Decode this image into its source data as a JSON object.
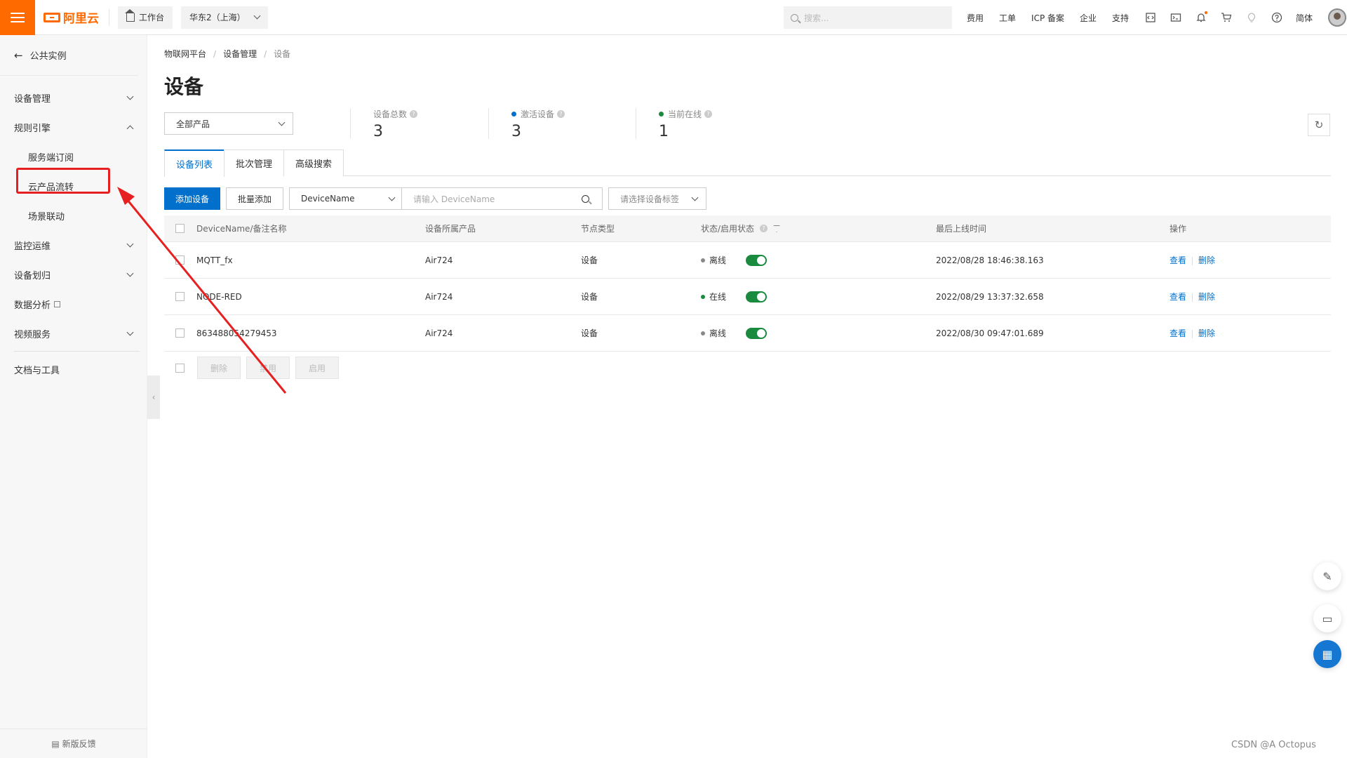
{
  "topbar": {
    "logo_text": "阿里云",
    "workbench_label": "工作台",
    "region_label": "华东2（上海）",
    "search_placeholder": "搜索...",
    "links": [
      "费用",
      "工单",
      "ICP 备案",
      "企业",
      "支持"
    ],
    "lang_label": "简体",
    "icons": [
      "code-icon",
      "terminal-icon",
      "bell-icon",
      "cart-icon",
      "bulb-icon",
      "help-icon"
    ]
  },
  "sidebar": {
    "back_label": "公共实例",
    "items": [
      {
        "label": "设备管理",
        "expanded": false
      },
      {
        "label": "规则引擎",
        "expanded": true
      },
      {
        "label": "服务端订阅",
        "sub": true
      },
      {
        "label": "云产品流转",
        "sub": true,
        "highlighted": true
      },
      {
        "label": "场景联动",
        "sub": true
      },
      {
        "label": "监控运维",
        "expanded": false
      },
      {
        "label": "设备划归",
        "expanded": false
      },
      {
        "label": "数据分析",
        "external": true
      },
      {
        "label": "视频服务",
        "expanded": false
      },
      {
        "label": "文档与工具"
      }
    ],
    "feedback_label": "新版反馈"
  },
  "main": {
    "breadcrumb": [
      "物联网平台",
      "设备管理",
      "设备"
    ],
    "title": "设备",
    "product_select": "全部产品",
    "stats": [
      {
        "label": "设备总数",
        "value": "3",
        "dot": null
      },
      {
        "label": "激活设备",
        "value": "3",
        "dot": "#0070cc"
      },
      {
        "label": "当前在线",
        "value": "1",
        "dot": "#1a8a3f"
      }
    ],
    "tabs": [
      "设备列表",
      "批次管理",
      "高级搜索"
    ],
    "toolbar": {
      "add_device": "添加设备",
      "batch_add": "批量添加",
      "field_select": "DeviceName",
      "search_placeholder": "请输入 DeviceName",
      "tag_placeholder": "请选择设备标签"
    },
    "table": {
      "headers": [
        "DeviceName/备注名称",
        "设备所属产品",
        "节点类型",
        "状态/启用状态",
        "最后上线时间",
        "操作"
      ],
      "rows": [
        {
          "name": "MQTT_fx",
          "product": "Air724",
          "node": "设备",
          "status": "离线",
          "status_color": "#888888",
          "enabled": true,
          "last_online": "2022/08/28 18:46:38.163",
          "view": "查看",
          "delete": "删除"
        },
        {
          "name": "NODE-RED",
          "product": "Air724",
          "node": "设备",
          "status": "在线",
          "status_color": "#1a8a3f",
          "enabled": true,
          "last_online": "2022/08/29 13:37:32.658",
          "view": "查看",
          "delete": "删除"
        },
        {
          "name": "863488054279453",
          "product": "Air724",
          "node": "设备",
          "status": "离线",
          "status_color": "#888888",
          "enabled": true,
          "last_online": "2022/08/30 09:47:01.689",
          "view": "查看",
          "delete": "删除"
        }
      ]
    },
    "bulk_actions": [
      "删除",
      "禁用",
      "启用"
    ]
  },
  "watermark": "CSDN @A   Octopus"
}
